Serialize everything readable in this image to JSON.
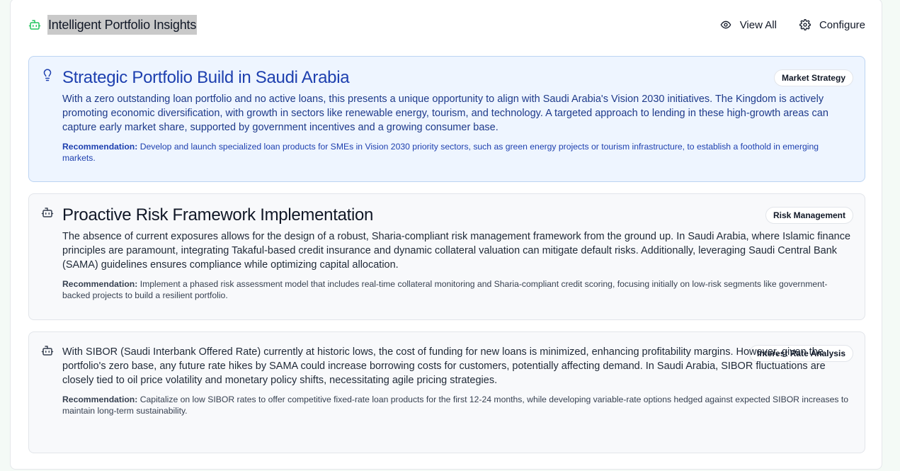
{
  "header": {
    "title": "Intelligent Portfolio Insights",
    "title_icon": "robot-icon",
    "actions": [
      {
        "label": "View All",
        "icon": "eye-icon"
      },
      {
        "label": "Configure",
        "icon": "gear-icon"
      }
    ]
  },
  "insights": [
    {
      "icon": "lightbulb-icon",
      "title": "Strategic Portfolio Build in Saudi Arabia",
      "badge": "Market Strategy",
      "description": "With a zero outstanding loan portfolio and no active loans, this presents a unique opportunity to align with Saudi Arabia's Vision 2030 initiatives. The Kingdom is actively promoting economic diversification, with growth in sectors like renewable energy, tourism, and technology. A targeted approach to lending in these high-growth areas can capture early market share, supported by government incentives and a growing consumer base.",
      "recommendation_label": "Recommendation:",
      "recommendation": " Develop and launch specialized loan products for SMEs in Vision 2030 priority sectors, such as green energy projects or tourism infrastructure, to establish a foothold in emerging markets."
    },
    {
      "icon": "robot-icon",
      "title": "Proactive Risk Framework Implementation",
      "badge": "Risk Management",
      "description": "The absence of current exposures allows for the design of a robust, Sharia-compliant risk management framework from the ground up. In Saudi Arabia, where Islamic finance principles are paramount, integrating Takaful-based credit insurance and dynamic collateral valuation can mitigate default risks. Additionally, leveraging Saudi Central Bank (SAMA) guidelines ensures compliance while optimizing capital allocation.",
      "recommendation_label": "Recommendation:",
      "recommendation": " Implement a phased risk assessment model that includes real-time collateral monitoring and Sharia-compliant credit scoring, focusing initially on low-risk segments like government-backed projects to build a resilient portfolio."
    },
    {
      "icon": "robot-icon",
      "title": "",
      "badge": "Interest Rate Analysis",
      "description": "With SIBOR (Saudi Interbank Offered Rate) currently at historic lows, the cost of funding for new loans is minimized, enhancing profitability margins. However, given the portfolio's zero base, any future rate hikes by SAMA could increase borrowing costs for customers, potentially affecting demand. In Saudi Arabia, SIBOR fluctuations are closely tied to oil price volatility and monetary policy shifts, necessitating agile pricing strategies.",
      "recommendation_label": "Recommendation:",
      "recommendation": " Capitalize on low SIBOR rates to offer competitive fixed-rate loan products for the first 12-24 months, while developing variable-rate options hedged against expected SIBOR increases to maintain long-term sustainability."
    }
  ],
  "colors": {
    "accent_green": "#22c55e",
    "highlight_bg": "#eef5ff",
    "highlight_text": "#1e40af"
  }
}
